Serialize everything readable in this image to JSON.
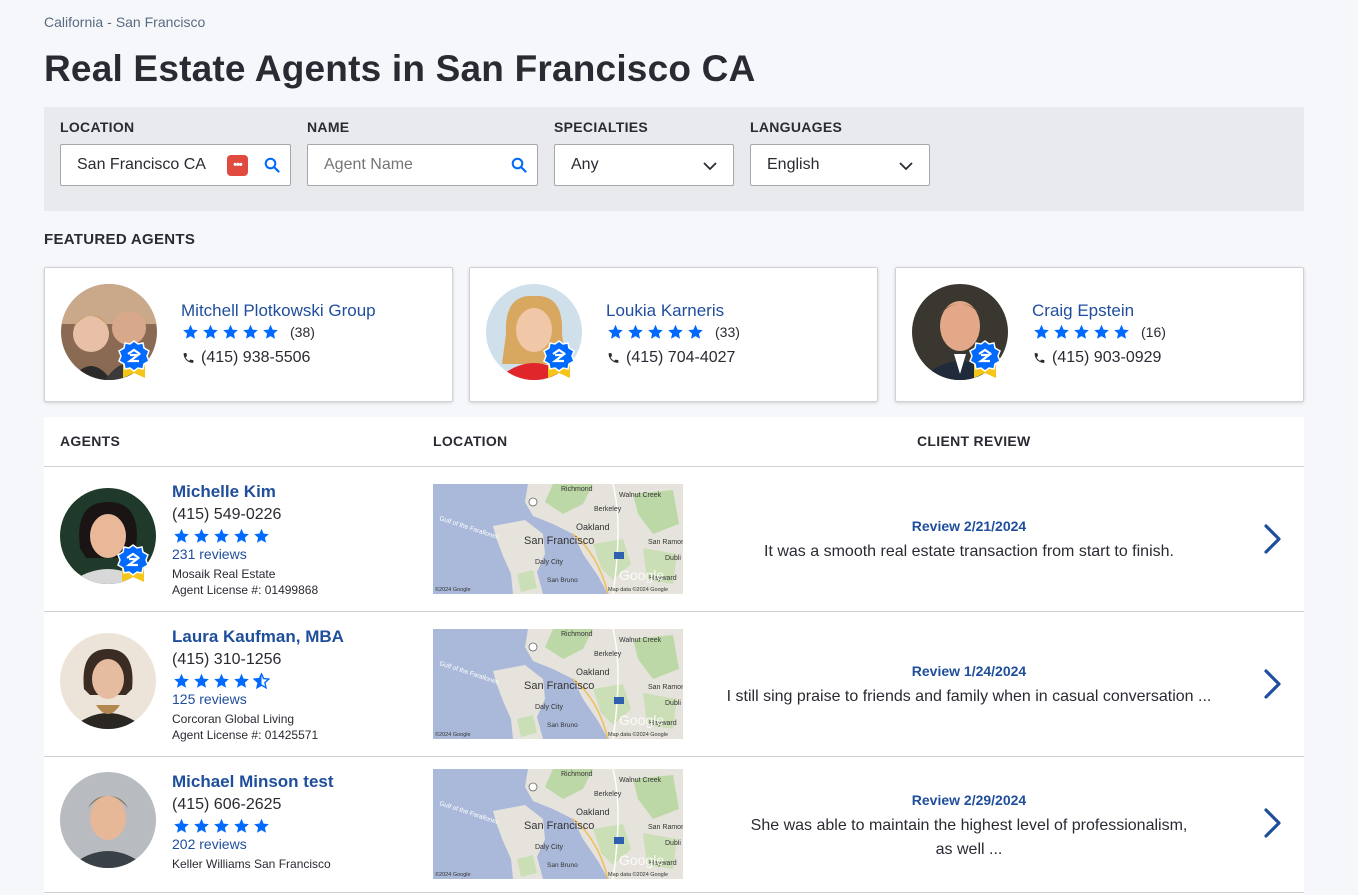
{
  "breadcrumb": {
    "state": "California",
    "sep": "-",
    "city": "San Francisco"
  },
  "page_title": "Real Estate Agents in San Francisco CA",
  "filters": {
    "location_label": "LOCATION",
    "location_value": "San Francisco CA",
    "name_label": "NAME",
    "name_placeholder": "Agent Name",
    "specialties_label": "SPECIALTIES",
    "specialties_value": "Any",
    "languages_label": "LANGUAGES",
    "languages_value": "English"
  },
  "featured": {
    "title": "FEATURED AGENTS",
    "agents": [
      {
        "name": "Mitchell Plotkowski Group",
        "rating": 5,
        "count": "(38)",
        "phone": "(415) 938-5506"
      },
      {
        "name": "Loukia Karneris",
        "rating": 5,
        "count": "(33)",
        "phone": "(415) 704-4027"
      },
      {
        "name": "Craig Epstein",
        "rating": 5,
        "count": "(16)",
        "phone": "(415) 903-0929"
      }
    ]
  },
  "table": {
    "headers": {
      "agents": "AGENTS",
      "location": "LOCATION",
      "review": "CLIENT REVIEW"
    },
    "rows": [
      {
        "name": "Michelle Kim",
        "phone": "(415) 549-0226",
        "rating": 5,
        "reviews": "231 reviews",
        "broker": "Mosaik Real Estate",
        "license": "Agent License #: 01499868",
        "review_date": "Review 2/21/2024",
        "review_text": "It was a smooth real estate transaction from start to finish."
      },
      {
        "name": "Laura Kaufman, MBA",
        "phone": "(415) 310-1256",
        "rating": 4.5,
        "reviews": "125 reviews",
        "broker": "Corcoran Global Living",
        "license": "Agent License #: 01425571",
        "review_date": "Review 1/24/2024",
        "review_text": "I still sing praise to friends and family when in casual conversation ..."
      },
      {
        "name": "Michael Minson test",
        "phone": "(415) 606-2625",
        "rating": 5,
        "reviews": "202 reviews",
        "broker": "Keller Williams San Francisco",
        "license": "",
        "review_date": "Review 2/29/2024",
        "review_text": "She was able to maintain the highest level of professionalism, as well ..."
      }
    ]
  },
  "map": {
    "labels": [
      "Richmond",
      "Walnut Creek",
      "Berkeley",
      "Oakland",
      "San Francisco",
      "San Ramon",
      "Gulf of the Farallones",
      "Daly City",
      "Dubli",
      "San Bruno",
      "Hayward",
      "Google",
      "©2024 Google",
      "Map data ©2024 Google"
    ]
  },
  "colors": {
    "accent": "#1f4e9c",
    "star": "#006aff",
    "badge_blue": "#006aff",
    "badge_ribbon": "#f5c518"
  }
}
